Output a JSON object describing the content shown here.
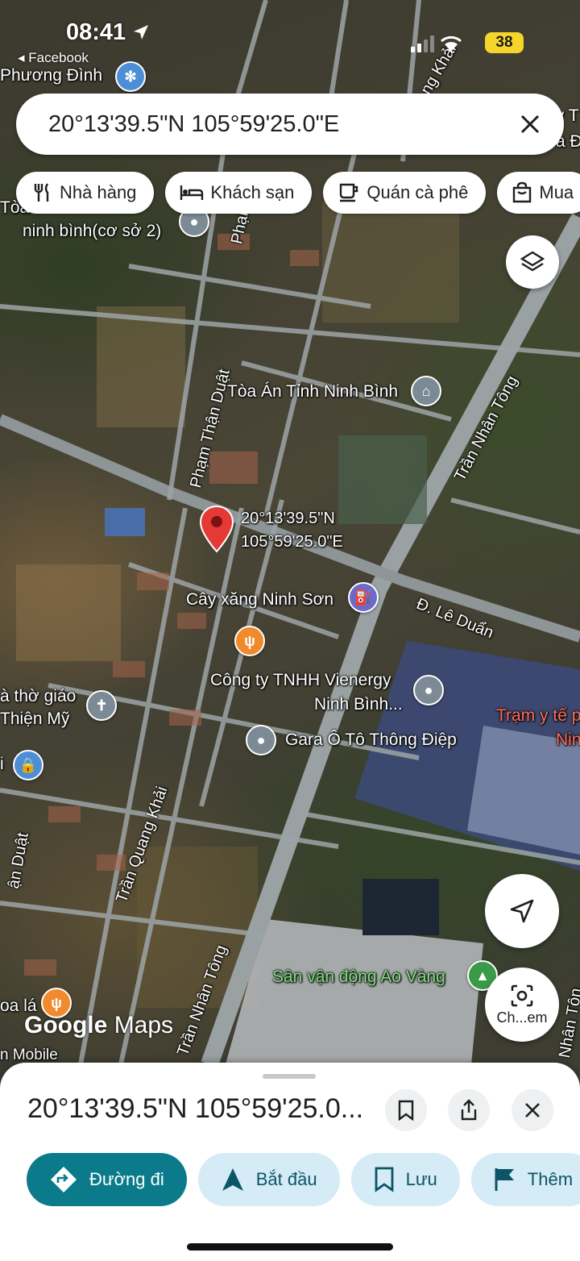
{
  "status_bar": {
    "time": "08:41",
    "back_app": "◂ Facebook",
    "battery": "38"
  },
  "search": {
    "value": "20°13'39.5\"N 105°59'25.0\"E"
  },
  "chips": [
    {
      "label": "Nhà hàng",
      "icon": "fork-knife-icon"
    },
    {
      "label": "Khách sạn",
      "icon": "bed-icon"
    },
    {
      "label": "Quán cà phê",
      "icon": "coffee-cup-icon"
    },
    {
      "label": "Mua",
      "icon": "shopping-bag-icon"
    }
  ],
  "map": {
    "pin_line1": "20°13'39.5\"N",
    "pin_line2": "105°59'25.0\"E",
    "places": {
      "phuong_dinh": "Phương Đình",
      "ninh_binh_top_a": "Tòa",
      "ninh_binh_top_b": "ninh bình(cơ sở 2)",
      "toa_an": "Tòa Án Tỉnh Ninh Bình",
      "cay_xang": "Cây xăng Ninh Sơn",
      "vienergy_1": "Công ty TNHH Vienergy",
      "vienergy_2": "Ninh Bình...",
      "gara": "Gara Ô Tô Thông Điệp",
      "church_1": "à thờ giáo",
      "church_2": "Thiện Mỹ",
      "tram_y_te_1": "Trạm y tế p",
      "tram_y_te_2": "Nin",
      "san_van_dong": "Sân vận động Ao Vàng",
      "oa_la": "oa lá",
      "mobile": "n Mobile",
      "top_right_a": "ty T",
      "top_right_b": "à Đ",
      "left_i": "i"
    },
    "roads": {
      "pham_than_duat_1": "Phạm Thận Duật",
      "pham_than_duat_2": "ận Duật",
      "pham_top": "Phạm",
      "tran_nhan_tong_1": "Trần Nhân Tông",
      "tran_nhan_tong_2": "Trần Nhân Tông",
      "tran_nhan_tong_3": "Nhân Tôn",
      "tran_quang_khai_1": "Trần Quang Khải",
      "tran_quang_khai_top": "ng Khải",
      "le_duan": "Đ. Lê Duẩn"
    },
    "google_logo": {
      "google": "Google",
      "maps": "Maps"
    },
    "camera_label": "Ch...em"
  },
  "sheet": {
    "title": "20°13'39.5\"N 105°59'25.0...",
    "actions": [
      {
        "label": "Đường đi",
        "icon": "directions-icon"
      },
      {
        "label": "Bắt đầu",
        "icon": "navigation-arrow-icon"
      },
      {
        "label": "Lưu",
        "icon": "bookmark-icon"
      },
      {
        "label": "Thêm",
        "icon": "flag-icon"
      }
    ]
  },
  "colors": {
    "primary_teal": "#0b7b8b",
    "secondary_chip": "#d5ebf6",
    "pin_red": "#e53935"
  }
}
